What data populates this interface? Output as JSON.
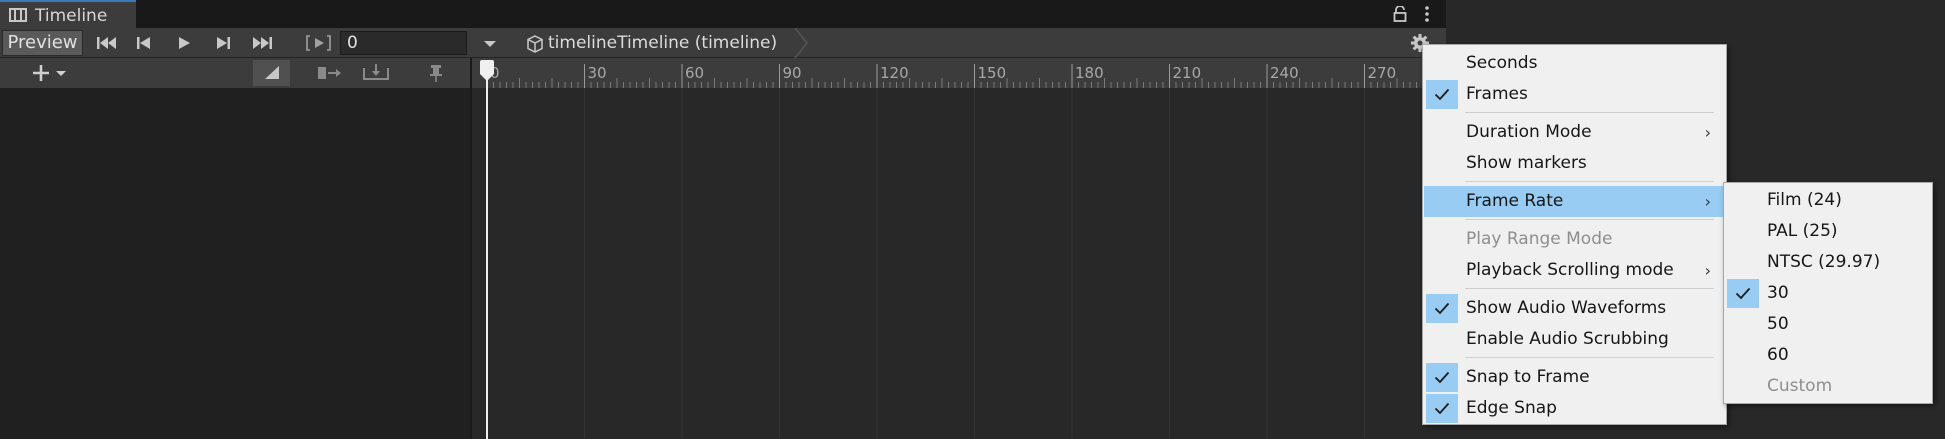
{
  "window": {
    "title": "Timeline"
  },
  "toolbar": {
    "preview_label": "Preview",
    "current_frame": "0",
    "breadcrumb": "timelineTimeline (timeline)"
  },
  "ruler": {
    "ticks": [
      "0",
      "30",
      "60",
      "90",
      "120",
      "150",
      "180",
      "210",
      "240",
      "270"
    ]
  },
  "settings_menu": {
    "items": [
      {
        "label": "Seconds",
        "checked": false
      },
      {
        "label": "Frames",
        "checked": true
      },
      {
        "label": "Duration Mode",
        "submenu": true
      },
      {
        "label": "Show markers"
      },
      {
        "label": "Frame Rate",
        "submenu": true,
        "highlighted": true
      },
      {
        "label": "Play Range Mode",
        "disabled": true
      },
      {
        "label": "Playback Scrolling mode",
        "submenu": true
      },
      {
        "label": "Show Audio Waveforms",
        "checked": true
      },
      {
        "label": "Enable Audio Scrubbing"
      },
      {
        "label": "Snap to Frame",
        "checked": true
      },
      {
        "label": "Edge Snap",
        "checked": true
      }
    ]
  },
  "frame_rate_menu": {
    "items": [
      {
        "label": "Film (24)"
      },
      {
        "label": "PAL (25)"
      },
      {
        "label": "NTSC (29.97)"
      },
      {
        "label": "30",
        "checked": true
      },
      {
        "label": "50"
      },
      {
        "label": "60"
      },
      {
        "label": "Custom",
        "disabled": true
      }
    ]
  },
  "colors": {
    "highlight": "#99ccf2",
    "accent_tab": "#3a79bb",
    "menu_bg": "#f0f0f0"
  }
}
